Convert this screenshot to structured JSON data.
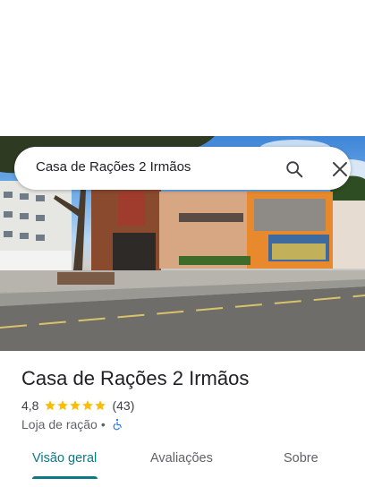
{
  "search": {
    "query": "Casa de Rações 2 Irmãos"
  },
  "place": {
    "title": "Casa de Rações 2 Irmãos",
    "rating": "4,8",
    "stars": 5,
    "review_count": "(43)",
    "category": "Loja de ração",
    "separator": "•"
  },
  "tabs": [
    {
      "label": "Visão geral",
      "active": true
    },
    {
      "label": "Avaliações",
      "active": false
    },
    {
      "label": "Sobre",
      "active": false
    }
  ],
  "colors": {
    "accent": "#0b7a85",
    "star": "#fbbc04",
    "accessibility": "#1a73e8"
  },
  "icons": {
    "search": "search-icon",
    "close": "close-icon",
    "star": "star-icon",
    "accessibility": "wheelchair-icon"
  }
}
